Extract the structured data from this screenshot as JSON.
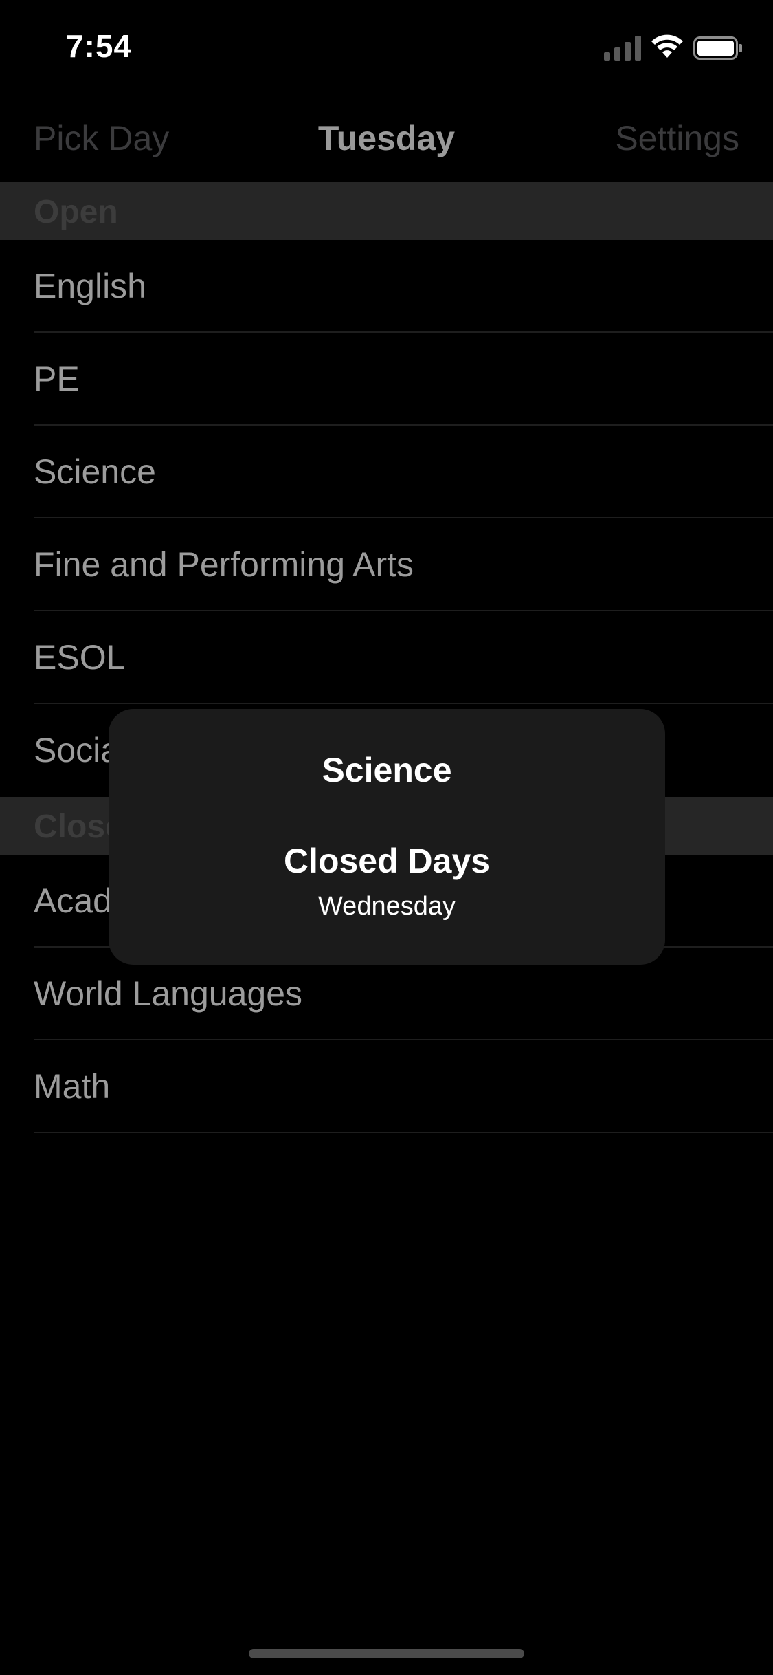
{
  "status_bar": {
    "time": "7:54",
    "icons": [
      "signal-icon",
      "wifi-icon",
      "battery-icon"
    ]
  },
  "nav": {
    "left_label": "Pick Day",
    "title": "Tuesday",
    "right_label": "Settings"
  },
  "sections": [
    {
      "header": "Open",
      "items": [
        "English",
        "PE",
        "Science",
        "Fine and Performing Arts",
        "ESOL",
        "Social Studies"
      ]
    },
    {
      "header": "Closed",
      "items": [
        "Academic",
        "World Languages",
        "Math"
      ]
    }
  ],
  "popup": {
    "title": "Science",
    "heading": "Closed Days",
    "value": "Wednesday"
  },
  "colors": {
    "background": "#000000",
    "section_header_bg": "#262626",
    "popup_bg": "#1b1b1b"
  }
}
